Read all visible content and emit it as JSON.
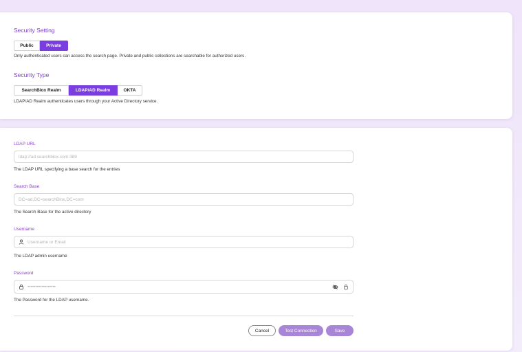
{
  "security": {
    "setting_title": "Security Setting",
    "setting_options": [
      "Public",
      "Private"
    ],
    "setting_selected": "Private",
    "setting_help": "Only authenticated users can access the search page. Private and public collections are searchable for authorized users.",
    "type_title": "Security Type",
    "type_options": [
      "SearchBlox Realm",
      "LDAP/AD Realm",
      "OKTA"
    ],
    "type_selected": "LDAP/AD Realm",
    "type_help": "LDAP/AD Realm authenticates users through your Active Directory service."
  },
  "ldap": {
    "url": {
      "label": "LDAP URL",
      "value": "",
      "placeholder": "ldap://ad.searchblox.com:389",
      "help": "The LDAP URL specifying a base search for the entries"
    },
    "search_base": {
      "label": "Search Base",
      "value": "",
      "placeholder": "DC=ad,DC=searchBlox,DC=com",
      "help": "The Search Base for the active directory"
    },
    "username": {
      "label": "Username",
      "value": "",
      "placeholder": "Username or Email",
      "help": "The LDAP admin username",
      "icon": "user-icon"
    },
    "password": {
      "label": "Password",
      "value": "",
      "placeholder": "••••••••••••••••••",
      "help": "The Password for the LDAP username.",
      "icon": "lock-icon",
      "toggle_icon": "eye-off-icon",
      "trail_icon": "lock-icon"
    }
  },
  "actions": {
    "cancel_label": "Cancel",
    "test_label": "Test Connection",
    "save_label": "Save"
  },
  "colors": {
    "accent": "#7a3ee0",
    "label": "#8a3fcf",
    "disabled_button": "#a985d8"
  }
}
